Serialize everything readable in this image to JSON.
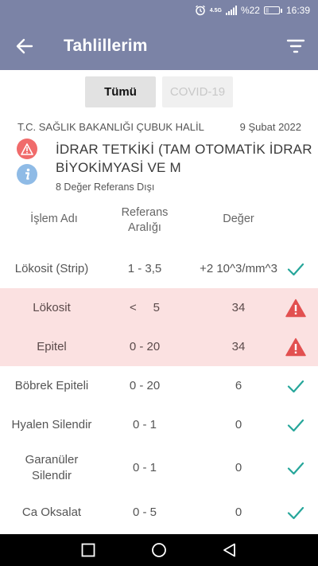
{
  "status_bar": {
    "signal_label": "4.5G",
    "battery_text": "%22",
    "battery_level": 0.22,
    "time": "16:39"
  },
  "app_bar": {
    "title": "Tahlillerim"
  },
  "tabs": [
    {
      "label": "Tümü",
      "selected": true
    },
    {
      "label": "COVID-19",
      "selected": false
    }
  ],
  "report": {
    "source": "T.C. SAĞLIK BAKANLIĞI ÇUBUK HALİL",
    "date": "9 Şubat 2022",
    "test_name": "İDRAR TETKİKİ (TAM OTOMATİK İDRAR BİYOKİMYASİ VE M",
    "out_of_range_text": "8 Değer Referans Dışı"
  },
  "table": {
    "headers": {
      "name": "İşlem Adı",
      "reference": "Referans Aralığı",
      "value": "Değer"
    },
    "rows": [
      {
        "name": "Lökosit  (Strip)",
        "reference": "1 - 3,5",
        "value": "+2 10^3/mm^3",
        "status": "normal"
      },
      {
        "name": "Lökosit",
        "reference": "<     5",
        "value": "34",
        "status": "abnormal"
      },
      {
        "name": "Epitel",
        "reference": "0 - 20",
        "value": "34",
        "status": "abnormal"
      },
      {
        "name": "Böbrek Epiteli",
        "reference": "0 - 20",
        "value": "6",
        "status": "normal"
      },
      {
        "name": "Hyalen Silendir",
        "reference": "0 - 1",
        "value": "0",
        "status": "normal"
      },
      {
        "name": "Garanüler Silendir",
        "reference": "0 - 1",
        "value": "0",
        "status": "normal"
      },
      {
        "name": "Ca Oksalat",
        "reference": "0 - 5",
        "value": "0",
        "status": "normal"
      }
    ]
  },
  "colors": {
    "primary": "#7b83a6",
    "abnormal_background": "#fbe1e1",
    "warning": "#e25050",
    "ok_check": "#26a69a",
    "info": "#8fbbe6"
  },
  "icons": {
    "back": "arrow-left-icon",
    "filter": "filter-icon",
    "warning": "warning-triangle-icon",
    "ok": "check-icon",
    "info": "info-icon"
  }
}
